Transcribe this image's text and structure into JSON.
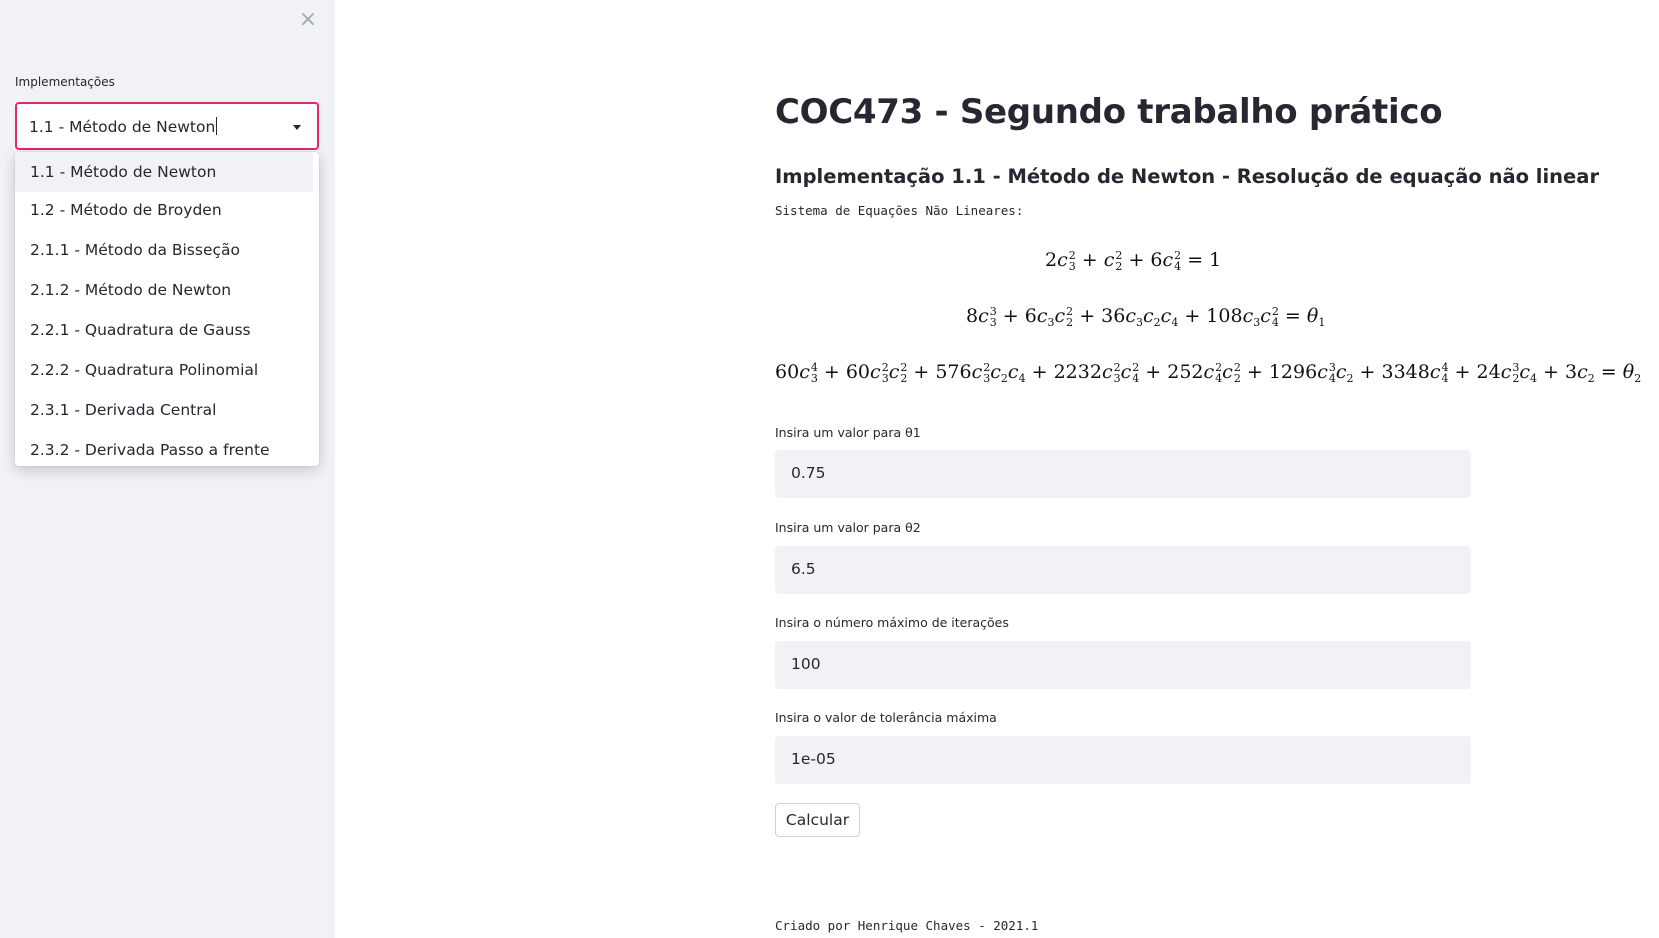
{
  "sidebar": {
    "close_icon": "×",
    "select_label": "Implementações",
    "select_value": "1.1 - Método de Newton",
    "options": [
      "1.1 - Método de Newton",
      "1.2 - Método de Broyden",
      "2.1.1 - Método da Bisseção",
      "2.1.2 - Método de Newton",
      "2.2.1 - Quadratura de Gauss",
      "2.2.2 - Quadratura Polinomial",
      "2.3.1 - Derivada Central",
      "2.3.2 - Derivada Passo a frente"
    ]
  },
  "main": {
    "title": "COC473 - Segundo trabalho prático",
    "subtitle": "Implementação 1.1 - Método de Newton - Resolução de equação não linear",
    "system_label": "Sistema de Equações Não Lineares:",
    "fields": [
      {
        "label": "Insira um valor para θ1",
        "value": "0.75"
      },
      {
        "label": "Insira um valor para θ2",
        "value": "6.5"
      },
      {
        "label": "Insira o número máximo de iterações",
        "value": "100"
      },
      {
        "label": "Insira o valor de tolerância máxima",
        "value": "1e-05"
      }
    ],
    "button_label": "Calcular",
    "footer": "Criado por Henrique Chaves - 2021.1"
  },
  "colors": {
    "sidebar_bg": "#f0f2f6",
    "select_border": "#e8266a",
    "input_bg": "#f0f2f6",
    "text": "#262730"
  }
}
